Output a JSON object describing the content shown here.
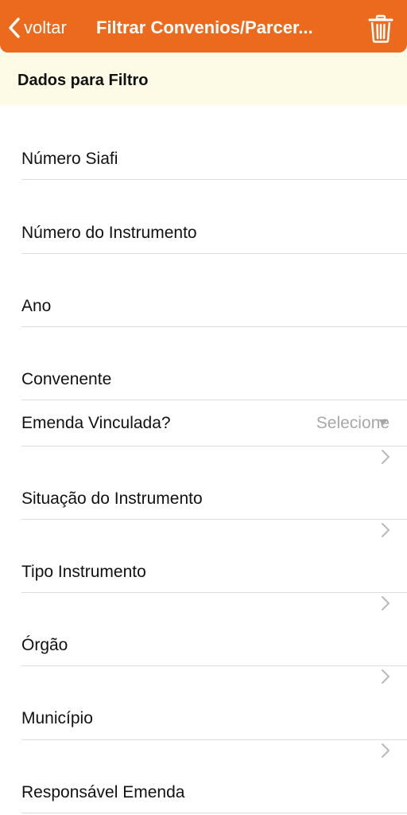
{
  "navbar": {
    "back_label": "voltar",
    "title": "Filtrar Convenios/Parcer...",
    "back_icon": "chevron-left-icon",
    "delete_icon": "trash-icon"
  },
  "section": {
    "title": "Dados para Filtro"
  },
  "fields": {
    "numero_siafi": "Número Siafi",
    "numero_instrumento": "Número do Instrumento",
    "ano": "Ano",
    "convenente": "Convenente",
    "emenda_vinculada": "Emenda Vinculada?",
    "emenda_vinculada_value": "Selecione",
    "situacao_instrumento": "Situação do Instrumento",
    "tipo_instrumento": "Tipo Instrumento",
    "orgao": "Órgão",
    "municipio": "Município",
    "responsavel_emenda": "Responsável Emenda"
  },
  "colors": {
    "accent": "#ec6a1e",
    "section_background": "#fdfbe6",
    "placeholder": "#a7a7a7"
  }
}
